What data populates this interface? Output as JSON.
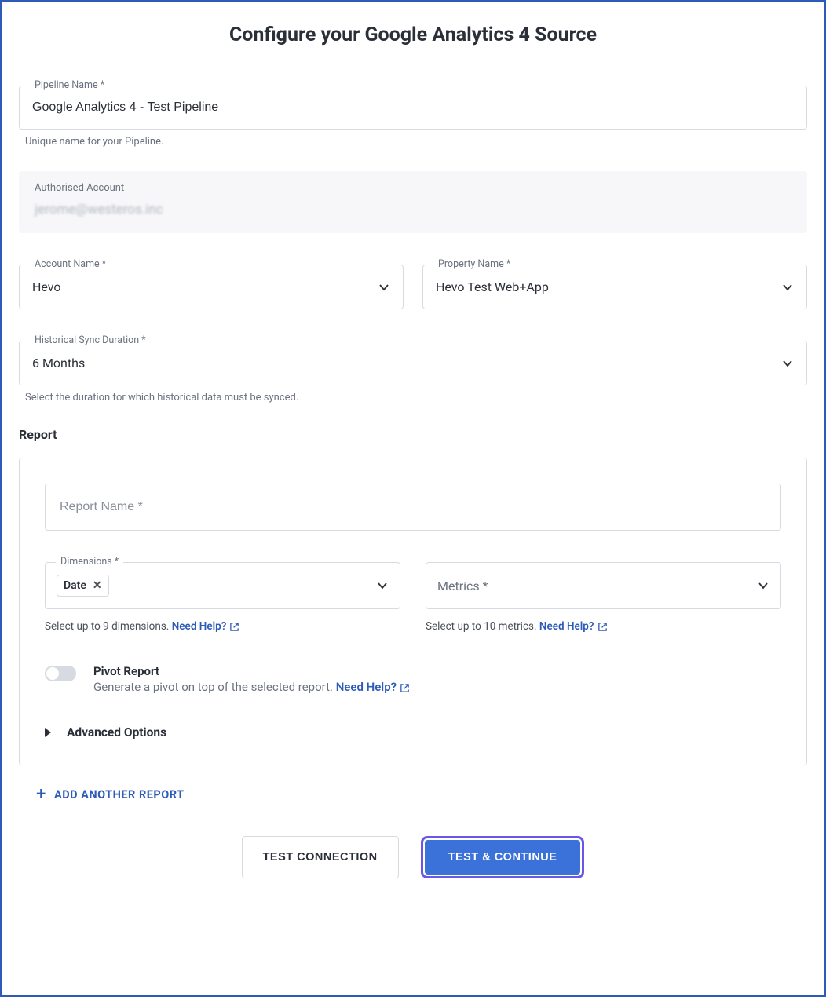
{
  "title": "Configure your Google Analytics 4 Source",
  "pipeline": {
    "label": "Pipeline Name *",
    "value": "Google Analytics 4 - Test Pipeline",
    "helper": "Unique name for your Pipeline."
  },
  "auth_account": {
    "label": "Authorised Account",
    "value": "jerome@westeros.inc"
  },
  "account_name": {
    "label": "Account Name *",
    "value": "Hevo"
  },
  "property_name": {
    "label": "Property Name *",
    "value": "Hevo Test Web+App"
  },
  "historical": {
    "label": "Historical Sync Duration *",
    "value": "6 Months",
    "helper": "Select the duration for which historical data must be synced."
  },
  "report_section_label": "Report",
  "report_name": {
    "placeholder": "Report Name *"
  },
  "dimensions": {
    "label": "Dimensions *",
    "chip": "Date",
    "helper": "Select up to 9 dimensions.",
    "help_link": "Need Help?"
  },
  "metrics": {
    "placeholder": "Metrics *",
    "helper": "Select up to 10 metrics.",
    "help_link": "Need Help?"
  },
  "pivot": {
    "title": "Pivot Report",
    "desc_prefix": "Generate a pivot on top of the selected report. ",
    "help_link": "Need Help?"
  },
  "advanced_label": "Advanced Options",
  "add_report_label": "ADD ANOTHER REPORT",
  "buttons": {
    "test_connection": "TEST CONNECTION",
    "test_continue": "TEST & CONTINUE"
  }
}
